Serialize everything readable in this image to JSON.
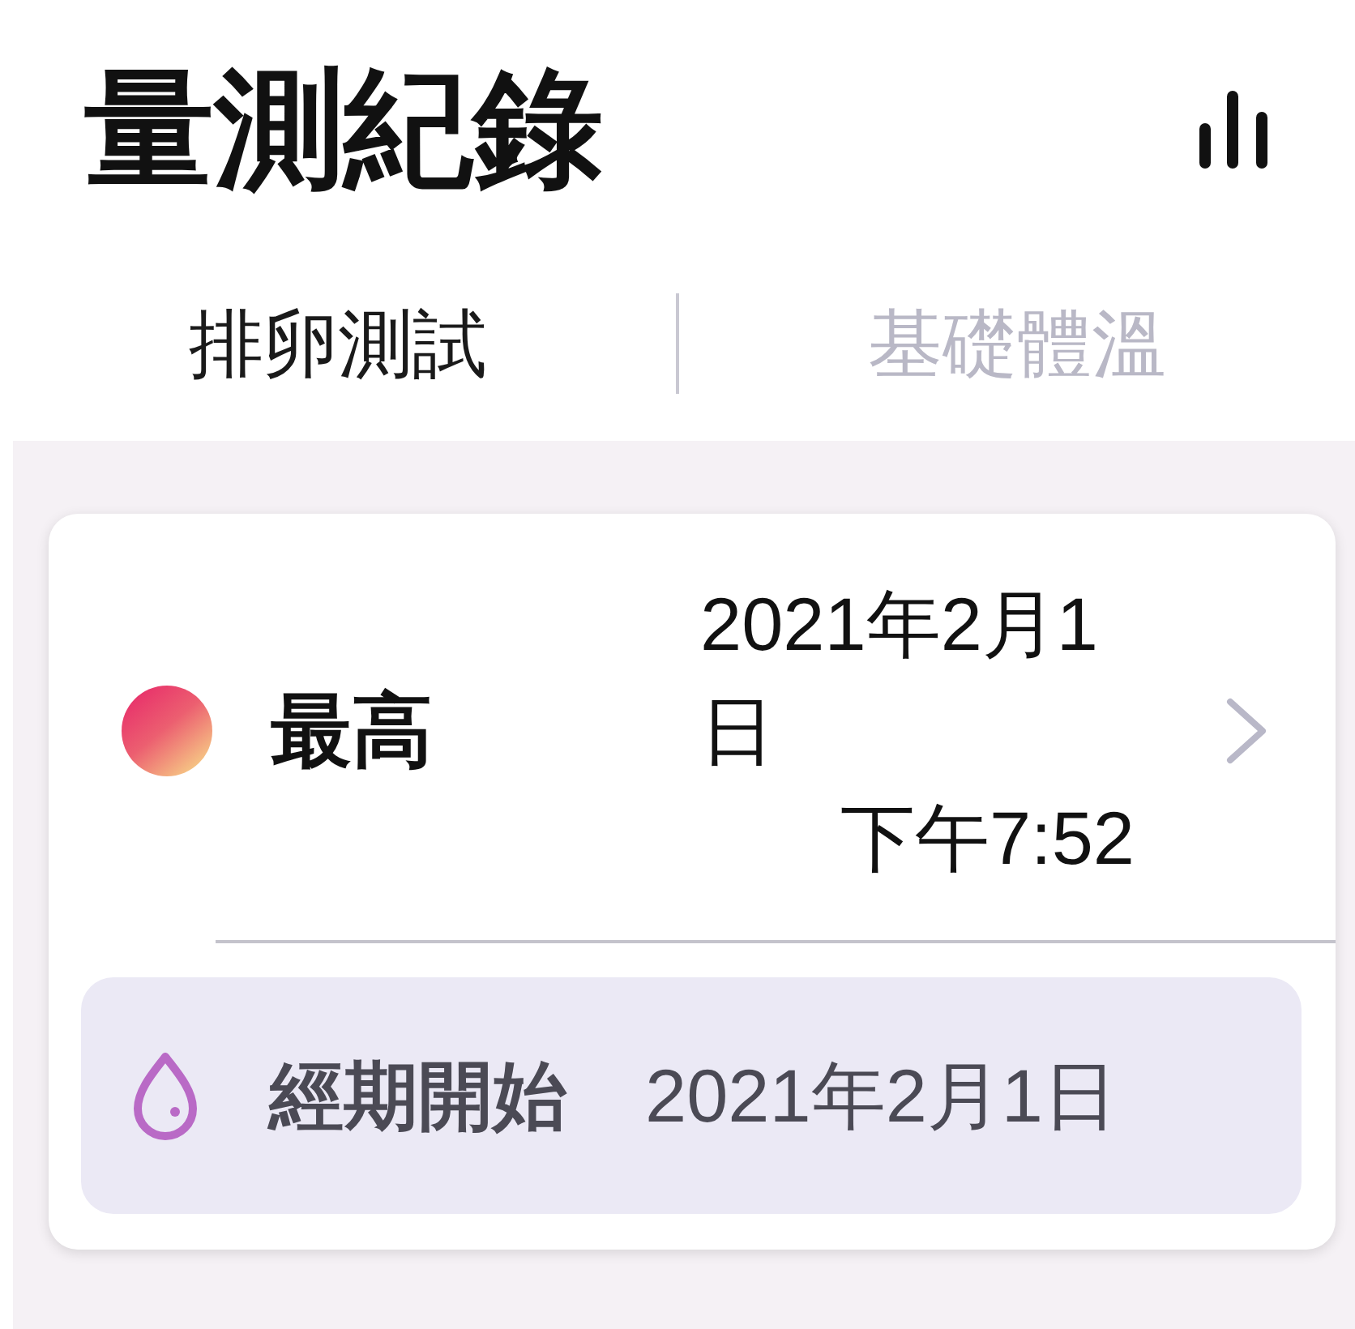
{
  "header": {
    "title": "量測紀錄"
  },
  "tabs": [
    {
      "label": "排卵測試",
      "selected": true
    },
    {
      "label": "基礎體溫",
      "selected": false
    }
  ],
  "records": [
    {
      "result": "最高",
      "date": "2021年2月1日",
      "time": "下午7:52",
      "note": {
        "label": "經期開始",
        "date": "2021年2月1日"
      }
    }
  ]
}
